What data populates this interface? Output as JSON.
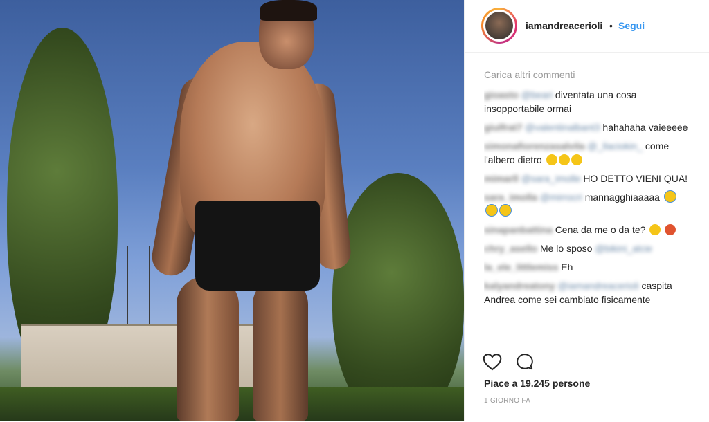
{
  "post": {
    "username": "iamandreacerioli",
    "separator": "•",
    "follow_label": "Segui"
  },
  "comments": {
    "load_more": "Carica altri commenti",
    "items": [
      {
        "user": "gioasto",
        "mention": "@beari",
        "text": "diventata una cosa insopportabile ormai"
      },
      {
        "user": "giulfrat7",
        "mention": "@valentinalbant3",
        "text": "hahahaha vaieeeee"
      },
      {
        "user": "simonafiorenzasalvila",
        "mention": "@_llaciokin_",
        "text": "come l'albero dietro"
      },
      {
        "user": "mimarll",
        "mention": "@sara_imolle",
        "text": "HO DETTO VIENI QUA!"
      },
      {
        "user": "sara_imolla",
        "mention": "@mirrocri",
        "text": "mannagghiaaaaa"
      },
      {
        "user": "sinapanbattina",
        "mention": "",
        "text": "Cena da me o da te?"
      },
      {
        "user": "chry_asello",
        "mention": "@bikini_alcie",
        "text": "Me lo sposo"
      },
      {
        "user": "la_ele_littlemiss",
        "mention": "",
        "text": "Eh"
      },
      {
        "user": "kalyandreatony",
        "mention": "@iamandreacerioli",
        "text": "caspita Andrea come sei cambiato fisicamente"
      }
    ]
  },
  "footer": {
    "likes": "Piace a 19.245 persone",
    "time": "1 GIORNO FA"
  },
  "colors": {
    "follow": "#3897f0",
    "text": "#262626",
    "muted": "#999999"
  }
}
